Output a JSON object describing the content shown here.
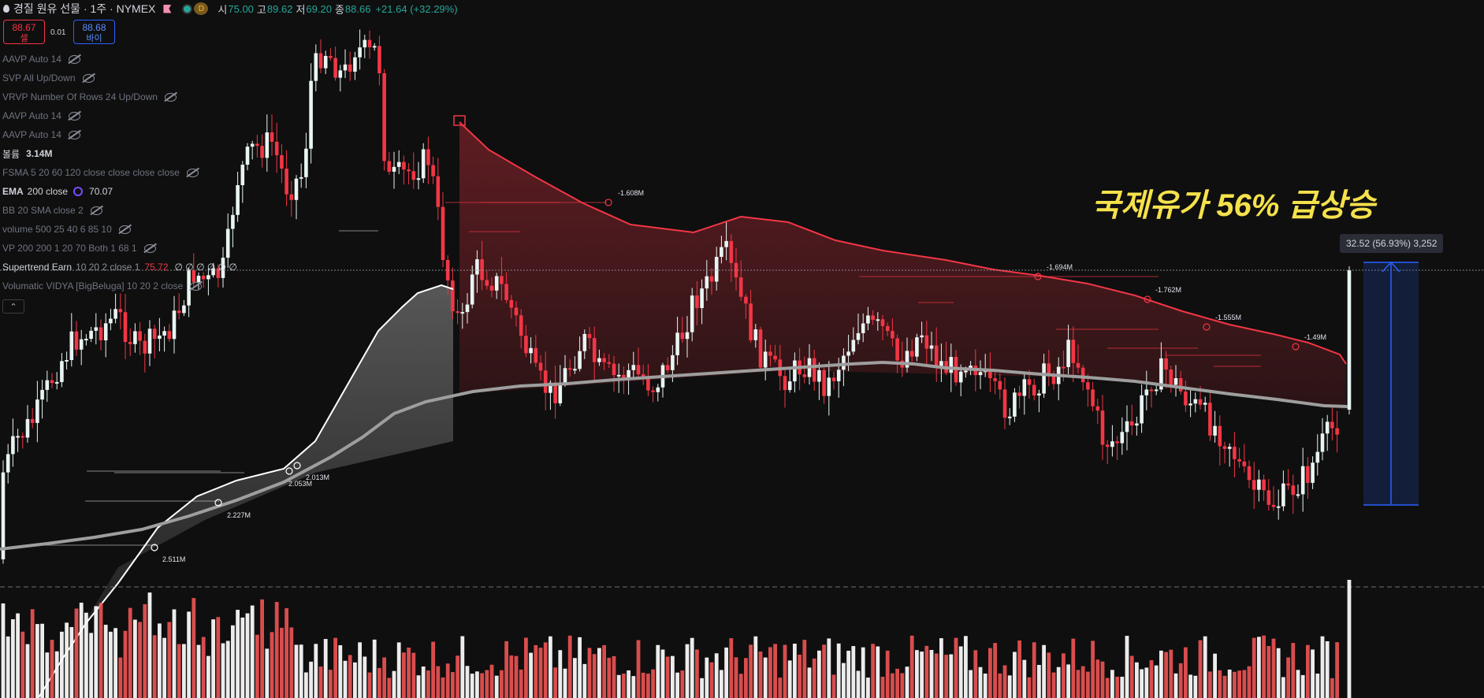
{
  "header": {
    "title": "경질 원유 선물 · 1주 · NYMEX",
    "session_badge": "D",
    "open_label": "시",
    "open_value": "75.00",
    "high_label": "고",
    "high_value": "89.62",
    "low_label": "저",
    "low_value": "69.20",
    "close_label": "종",
    "close_value": "88.66",
    "change": "+21.64 (+32.29%)"
  },
  "trade": {
    "sell_price": "88.67",
    "sell_label": "셀",
    "spread": "0.01",
    "buy_price": "88.68",
    "buy_label": "바이"
  },
  "indicators": [
    {
      "name": "AAVP Auto 14"
    },
    {
      "name": "SVP All Up/Down"
    },
    {
      "name": "VRVP Number Of Rows 24 Up/Down"
    },
    {
      "name": "AAVP Auto 14"
    },
    {
      "name": "AAVP Auto 14"
    },
    {
      "name": "볼륨",
      "value": "3.14M"
    },
    {
      "name": "FSMA 5 20 60 120 close close close close"
    },
    {
      "name": "EMA",
      "params": "200 close",
      "value": "70.07"
    },
    {
      "name": "BB 20 SMA close 2"
    },
    {
      "name": "volume 500 25 40 6 85 10"
    },
    {
      "name": "VP 200 200 1 20 70 Both 1 68 1"
    },
    {
      "name": "Supertrend Earn",
      "params": "10 20 2 close 1",
      "value": "75.72",
      "extra": "∅ ∅ ∅ ∅ ∅ ∅"
    },
    {
      "name": "Volumatic VIDYA [BigBeluga] 10 20 2 close"
    }
  ],
  "collapse_icon": "chevron-up-icon",
  "headline": "국제유가 56% 급상승",
  "measure_label": "32.52 (56.93%) 3,252",
  "annotations": {
    "volume_labels": [
      "-1.608M",
      "-1.694M",
      "-1.762M",
      "-1.555M",
      "-1.49M",
      "2.227M",
      "2.511M",
      "2.013M",
      "2.053M"
    ]
  },
  "colors": {
    "up": "#e8f5f3",
    "down": "#f23645",
    "up_volume": "#ffffff",
    "down_volume": "#f05454",
    "ema": "#9e9e9e",
    "supertrend": "#f23645",
    "vidya": "#ffffff",
    "headline": "#f5e14b",
    "measure": "#2962ff"
  },
  "chart_data": {
    "type": "candlestick",
    "price_range": [
      40,
      140
    ],
    "last_close": 88.66,
    "ema_200": 70.07
  }
}
